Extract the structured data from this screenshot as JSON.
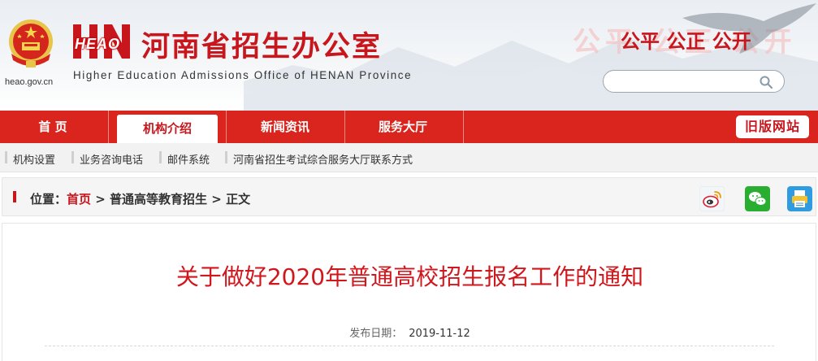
{
  "header": {
    "domain": "heao.gov.cn",
    "logo_text": "HEAO",
    "office_name": "河南省招生办公室",
    "office_name_en": "Higher Education Admissions Office of HENAN Province",
    "slogan": "公平 公正 公开",
    "slogan_background": "公平 公正 公开",
    "search": {
      "placeholder": "",
      "value": ""
    }
  },
  "nav": {
    "items": [
      {
        "label": "首 页",
        "active": false
      },
      {
        "label": "机构介绍",
        "active": true
      },
      {
        "label": "新闻资讯",
        "active": false
      },
      {
        "label": "服务大厅",
        "active": false
      }
    ],
    "old_site_label": "旧版网站"
  },
  "subnav": {
    "items": [
      {
        "label": "机构设置"
      },
      {
        "label": "业务咨询电话"
      },
      {
        "label": "邮件系统"
      },
      {
        "label": "河南省招生考试综合服务大厅联系方式"
      }
    ]
  },
  "location": {
    "prefix": "位置：",
    "home": "首页",
    "sep1": " > ",
    "category": "普通高等教育招生",
    "sep2": " > ",
    "current": "正文"
  },
  "share": {
    "items": [
      {
        "icon": "weibo-icon",
        "color": "#e6162d"
      },
      {
        "icon": "wechat-icon",
        "color": "#2aae32"
      },
      {
        "icon": "print-icon",
        "color": "#2f9be0"
      }
    ]
  },
  "article": {
    "title": "关于做好2020年普通高校招生报名工作的通知",
    "date_label": "发布日期：",
    "date": "2019-11-12"
  },
  "colors": {
    "brand_red": "#d9251d",
    "title_red": "#d1161c"
  }
}
